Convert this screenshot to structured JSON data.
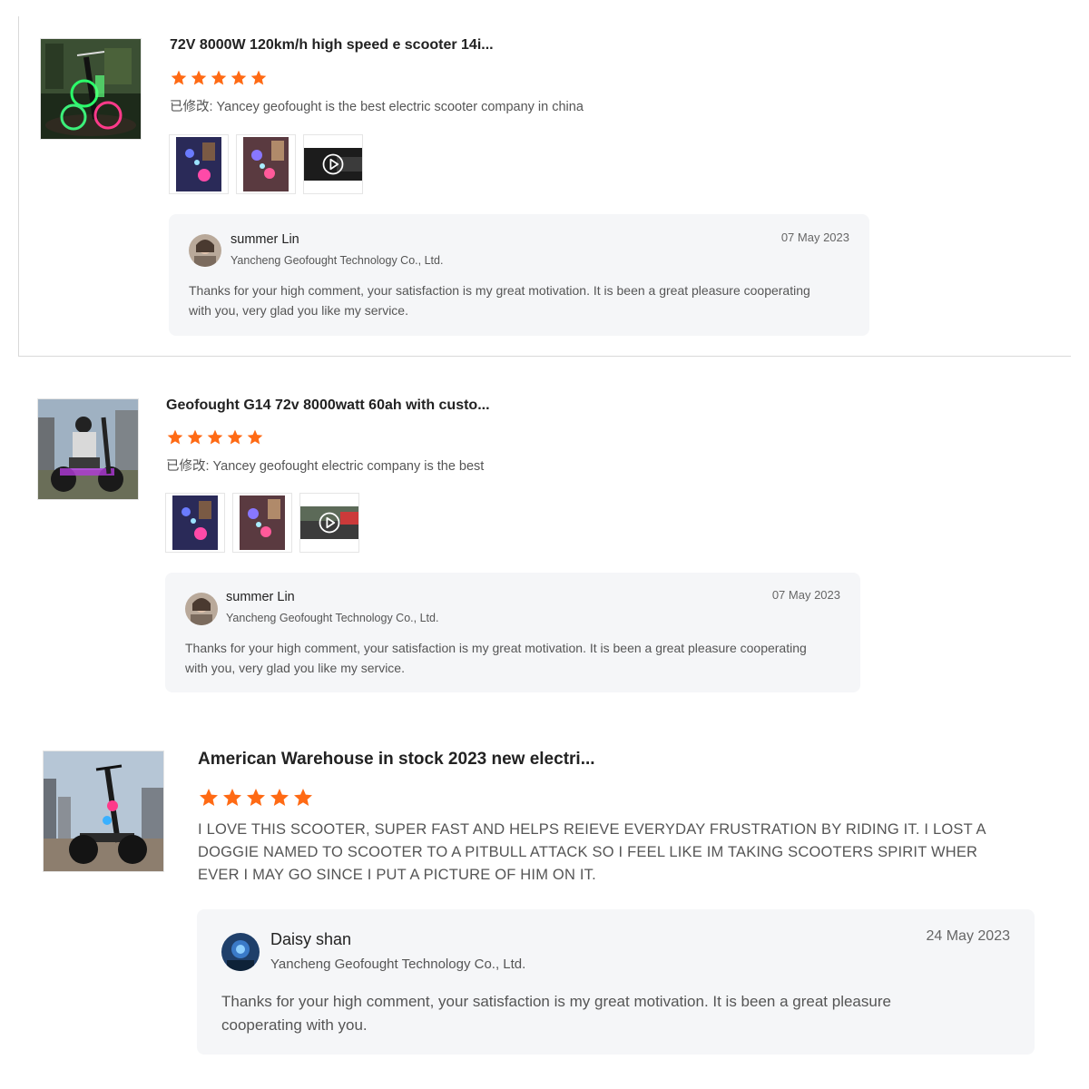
{
  "colors": {
    "star": "#ff6a14",
    "reply_bg": "#f5f6f8",
    "divider": "#d9d9d9"
  },
  "icons": {
    "star": "star-icon",
    "play": "play-icon"
  },
  "reviews": [
    {
      "title": "72V 8000W 120km/h high speed e scooter 14i...",
      "rating": 5,
      "comment": "已修改: Yancey geofought is the best electric scooter company in china",
      "media": [
        "photo",
        "photo",
        "video"
      ],
      "reply": {
        "name": "summer Lin",
        "company": "Yancheng Geofought Technology Co., Ltd.",
        "date": "07 May 2023",
        "text": "Thanks for your high comment, your satisfaction is my great motivation. It is been a great pleasure cooperating with you, very glad you like my service."
      }
    },
    {
      "title": "Geofought G14 72v 8000watt 60ah with custo...",
      "rating": 5,
      "comment": "已修改: Yancey geofought electric company is the best",
      "media": [
        "photo",
        "photo",
        "video"
      ],
      "reply": {
        "name": "summer Lin",
        "company": "Yancheng Geofought Technology Co., Ltd.",
        "date": "07 May 2023",
        "text": "Thanks for your high comment, your satisfaction is my great motivation. It is been a great pleasure cooperating with you, very glad you like my service."
      }
    },
    {
      "title": "American Warehouse in stock 2023 new electri...",
      "rating": 5,
      "comment": "I LOVE THIS SCOOTER, SUPER FAST AND HELPS REIEVE EVERYDAY FRUSTRATION BY RIDING IT. I LOST A DOGGIE NAMED TO SCOOTER TO A PITBULL ATTACK SO I FEEL LIKE IM TAKING SCOOTERS SPIRIT WHER EVER I MAY GO SINCE I PUT A PICTURE OF HIM ON IT.",
      "reply": {
        "name": "Daisy shan",
        "company": "Yancheng Geofought Technology Co., Ltd.",
        "date": "24 May 2023",
        "text": "Thanks for your high comment, your satisfaction is my great motivation. It is been a great pleasure cooperating with you."
      }
    }
  ]
}
